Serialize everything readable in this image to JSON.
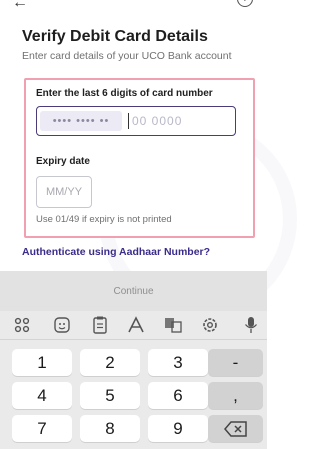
{
  "header": {
    "back_icon": "back-arrow-icon",
    "help_icon": "help-icon",
    "help_glyph": "?"
  },
  "page": {
    "title": "Verify Debit Card Details",
    "subtitle": "Enter card details of your UCO Bank account"
  },
  "card": {
    "label": "Enter the last 6 digits of card number",
    "masked_text": "•••• •••• ••",
    "input_value": "",
    "input_placeholder": "00 0000",
    "highlight_color": "#f0a0b0",
    "focus_color": "#4b3b7a"
  },
  "expiry": {
    "label": "Expiry date",
    "input_value": "",
    "placeholder": "MM/YY",
    "hint": "Use 01/49 if expiry is not printed"
  },
  "aadhaar_link": {
    "label": "Authenticate using Aadhaar Number?",
    "color": "#3a2c8a"
  },
  "cta": {
    "label": "Continue",
    "state": "disabled"
  },
  "keyboard": {
    "toolbar_icons": [
      "grid-icon",
      "sticker-icon",
      "clipboard-icon",
      "text-style-icon",
      "translate-icon",
      "settings-icon",
      "mic-icon"
    ],
    "keys": [
      [
        "1",
        "2",
        "3",
        "-"
      ],
      [
        "4",
        "5",
        "6",
        ","
      ],
      [
        "7",
        "8",
        "9",
        "backspace"
      ]
    ]
  }
}
